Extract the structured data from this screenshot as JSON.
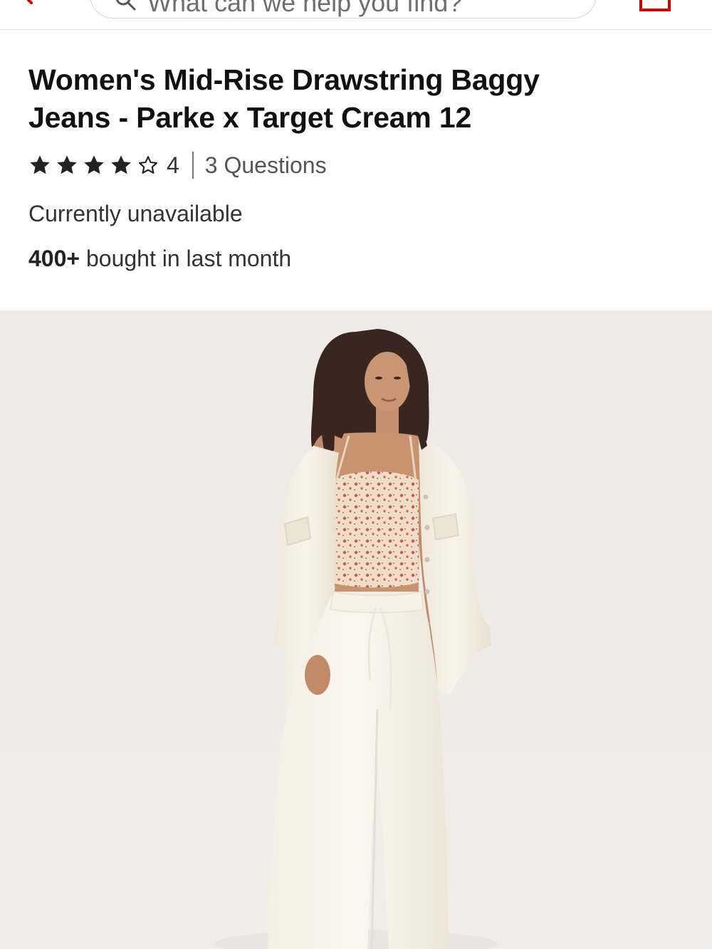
{
  "header": {
    "search_placeholder": "What can we help you find?",
    "icons": {
      "back": "chevron-left-icon",
      "search": "search-icon",
      "cart": "cart-icon"
    },
    "accent_color": "#cc0000"
  },
  "product": {
    "title_line1": "Women's Mid-Rise Drawstring Baggy",
    "title_line2": "Jeans - Parke x Target Cream 12",
    "rating": 4,
    "rating_max": 5,
    "rating_label": "4",
    "questions_label": "3 Questions",
    "availability": "Currently unavailable",
    "bought_count": "400+",
    "bought_suffix": " bought in last month"
  },
  "image": {
    "subject": "model wearing cream drawstring baggy jeans, cream oversized jacket and floral cami",
    "background_color": "#eeeae5"
  }
}
